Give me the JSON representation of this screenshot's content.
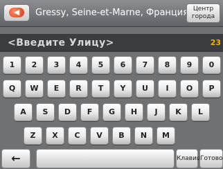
{
  "header": {
    "back_icon": "arrow-left-icon",
    "location": "Gressy, Seine-et-Marne, Франция",
    "center_button": {
      "line1": "Центр",
      "line2": "города"
    }
  },
  "input": {
    "placeholder": "<Введите Улицу>",
    "count": "23"
  },
  "keyboard": {
    "rows": [
      [
        "1",
        "2",
        "3",
        "4",
        "5",
        "6",
        "7",
        "8",
        "9",
        "0"
      ],
      [
        "Q",
        "W",
        "E",
        "R",
        "T",
        "Y",
        "U",
        "I",
        "O",
        "P"
      ],
      [
        "A",
        "S",
        "D",
        "F",
        "G",
        "H",
        "J",
        "K",
        "L"
      ],
      [
        "Z",
        "X",
        "C",
        "V",
        "B",
        "N",
        "M"
      ]
    ],
    "backspace": "←",
    "keys_label": "Клавиши",
    "done_label": "Готово"
  }
}
